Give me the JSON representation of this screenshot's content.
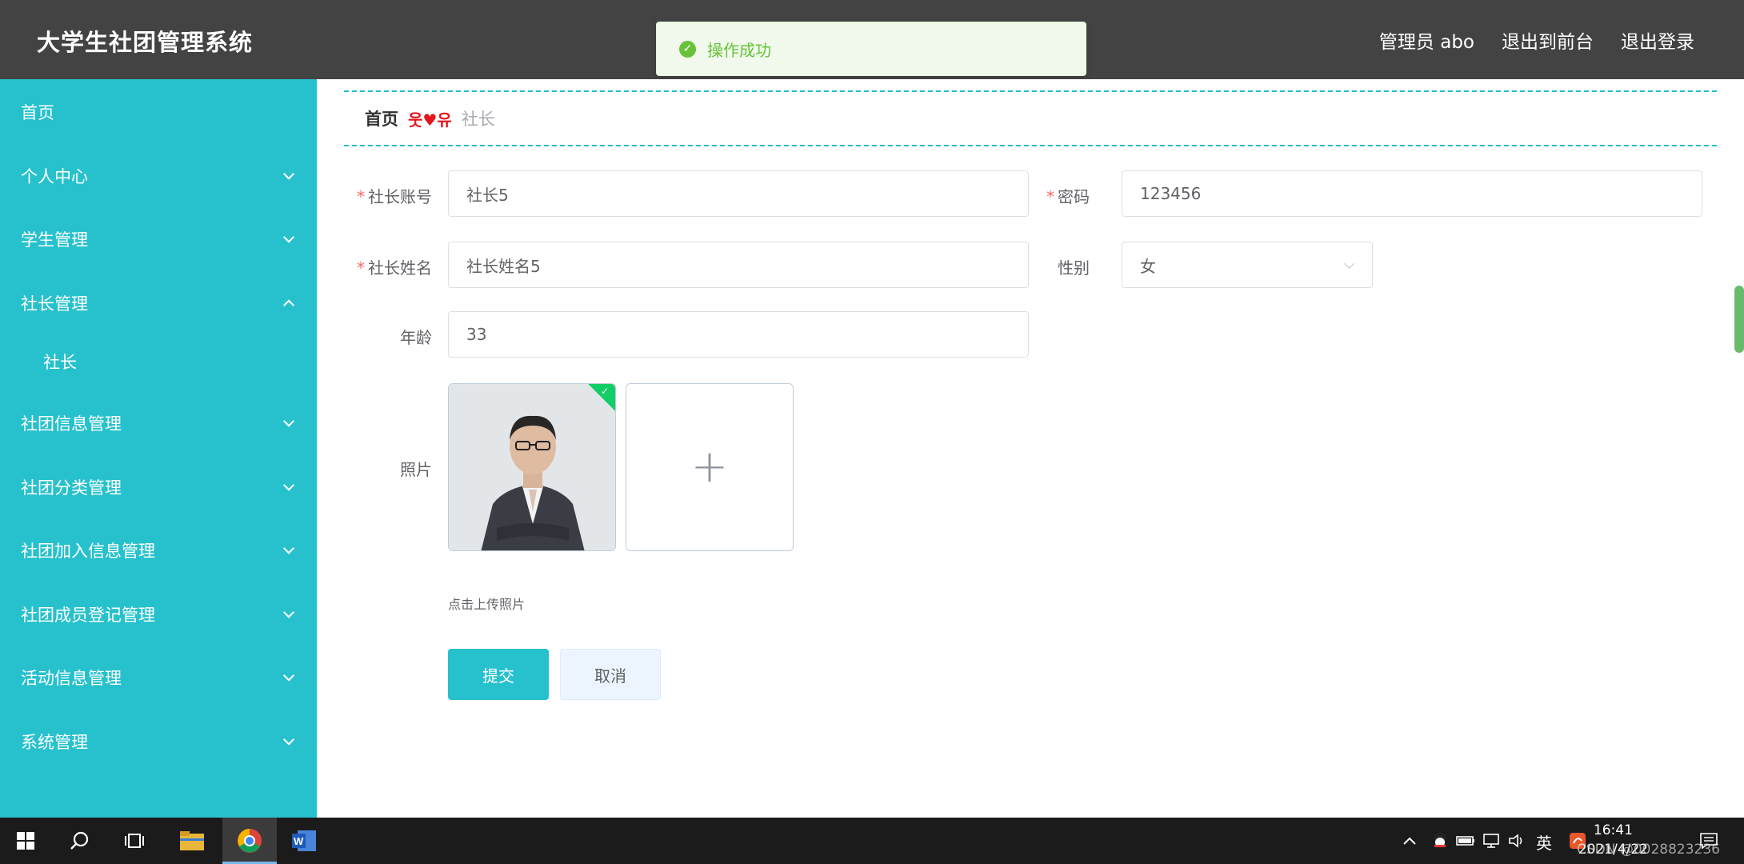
{
  "header": {
    "title": "大学生社团管理系统",
    "user": "管理员 abo",
    "to_front": "退出到前台",
    "logout": "退出登录"
  },
  "toast": {
    "message": "操作成功",
    "color": "#67c23a"
  },
  "sidebar": {
    "bg_color": "#27c1cd",
    "items": [
      {
        "label": "首页"
      },
      {
        "label": "个人中心"
      },
      {
        "label": "学生管理"
      },
      {
        "label": "社长管理"
      },
      {
        "label": "社长"
      },
      {
        "label": "社团信息管理"
      },
      {
        "label": "社团分类管理"
      },
      {
        "label": "社团加入信息管理"
      },
      {
        "label": "社团成员登记管理"
      },
      {
        "label": "活动信息管理"
      },
      {
        "label": "系统管理"
      }
    ]
  },
  "breadcrumb": {
    "home": "首页",
    "separator": "웃♥유",
    "current": "社长"
  },
  "form": {
    "account_label": "社长账号",
    "account_value": "社长5",
    "password_label": "密码",
    "password_value": "123456",
    "name_label": "社长姓名",
    "name_value": "社长姓名5",
    "gender_label": "性别",
    "gender_value": "女",
    "age_label": "年龄",
    "age_value": "33",
    "photo_label": "照片",
    "upload_plus": "+",
    "upload_hint": "点击上传照片",
    "submit_label": "提交",
    "cancel_label": "取消"
  },
  "taskbar": {
    "tray_lang": "英",
    "time": "16:41",
    "date": "2021/4/22",
    "watermark": "CSDN @0028823236"
  },
  "colors": {
    "accent": "#27c1cd",
    "header": "#434343",
    "required": "#f56c6c"
  }
}
